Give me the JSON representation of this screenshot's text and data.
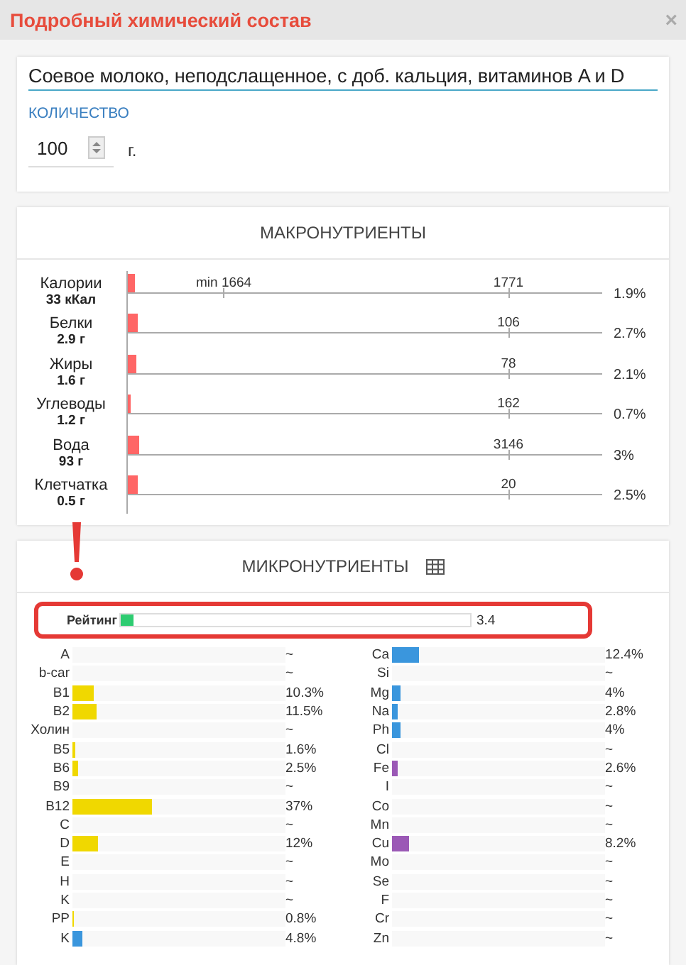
{
  "window": {
    "title": "Подробный химический состав",
    "close": "×"
  },
  "product": {
    "name": "Соевое молоко, неподслащенное, с доб. кальция, витаминов A и D",
    "quantity_label": "КОЛИЧЕСТВО",
    "quantity": "100",
    "unit": "г."
  },
  "macronutrients": {
    "title": "МАКРОНУТРИЕНТЫ",
    "min_label": "min 1664",
    "rows": [
      {
        "name": "Калории",
        "amount": "33 кКал",
        "norm": "1771",
        "level": 0.019,
        "percent": "1.9%"
      },
      {
        "name": "Белки",
        "amount": "2.9 г",
        "norm": "106",
        "level": 0.027,
        "percent": "2.7%"
      },
      {
        "name": "Жиры",
        "amount": "1.6 г",
        "norm": "78",
        "level": 0.021,
        "percent": "2.1%"
      },
      {
        "name": "Углеводы",
        "amount": "1.2 г",
        "norm": "162",
        "level": 0.007,
        "percent": "0.7%"
      },
      {
        "name": "Вода",
        "amount": "93 г",
        "norm": "3146",
        "level": 0.03,
        "percent": "3%"
      },
      {
        "name": "Клетчатка",
        "amount": "0.5 г",
        "norm": "20",
        "level": 0.025,
        "percent": "2.5%"
      }
    ]
  },
  "micronutrients": {
    "title": "МИКРОНУТРИЕНТЫ",
    "rating": {
      "label": "Рейтинг",
      "level": 0.034,
      "value": "3.4",
      "highlighted": true
    },
    "vitamins": [
      {
        "name": "A",
        "value": "~"
      },
      {
        "name": "b-car",
        "value": "~"
      },
      {
        "name": "B1",
        "level": 0.103,
        "color": "#f0d800",
        "value": "10.3%"
      },
      {
        "name": "B2",
        "level": 0.115,
        "color": "#f0d800",
        "value": "11.5%"
      },
      {
        "name": "Холин",
        "value": "~"
      },
      {
        "name": "B5",
        "level": 0.016,
        "color": "#f0d800",
        "value": "1.6%"
      },
      {
        "name": "B6",
        "level": 0.025,
        "color": "#f0d800",
        "value": "2.5%"
      },
      {
        "name": "B9",
        "value": "~"
      },
      {
        "name": "B12",
        "level": 0.37,
        "color": "#f0d800",
        "value": "37%"
      },
      {
        "name": "C",
        "value": "~"
      },
      {
        "name": "D",
        "level": 0.12,
        "color": "#f0d800",
        "value": "12%"
      },
      {
        "name": "E",
        "value": "~"
      },
      {
        "name": "H",
        "value": "~"
      },
      {
        "name": "K",
        "value": "~"
      },
      {
        "name": "PP",
        "level": 0.008,
        "color": "#f0d800",
        "value": "0.8%"
      },
      {
        "name": "K",
        "level": 0.048,
        "color": "#3a96dd",
        "value": "4.8%"
      }
    ],
    "minerals": [
      {
        "name": "Ca",
        "level": 0.124,
        "color": "#3a96dd",
        "value": "12.4%"
      },
      {
        "name": "Si",
        "value": "~"
      },
      {
        "name": "Mg",
        "level": 0.04,
        "color": "#3a96dd",
        "value": "4%"
      },
      {
        "name": "Na",
        "level": 0.028,
        "color": "#3a96dd",
        "value": "2.8%"
      },
      {
        "name": "Ph",
        "level": 0.04,
        "color": "#3a96dd",
        "value": "4%"
      },
      {
        "name": "Cl",
        "value": "~"
      },
      {
        "name": "Fe",
        "level": 0.026,
        "color": "#9b59b6",
        "value": "2.6%"
      },
      {
        "name": "I",
        "value": "~"
      },
      {
        "name": "Co",
        "value": "~"
      },
      {
        "name": "Mn",
        "value": "~"
      },
      {
        "name": "Cu",
        "level": 0.082,
        "color": "#9b59b6",
        "value": "8.2%"
      },
      {
        "name": "Mo",
        "value": "~"
      },
      {
        "name": "Se",
        "value": "~"
      },
      {
        "name": "F",
        "value": "~"
      },
      {
        "name": "Cr",
        "value": "~"
      },
      {
        "name": "Zn",
        "value": "~"
      }
    ]
  }
}
